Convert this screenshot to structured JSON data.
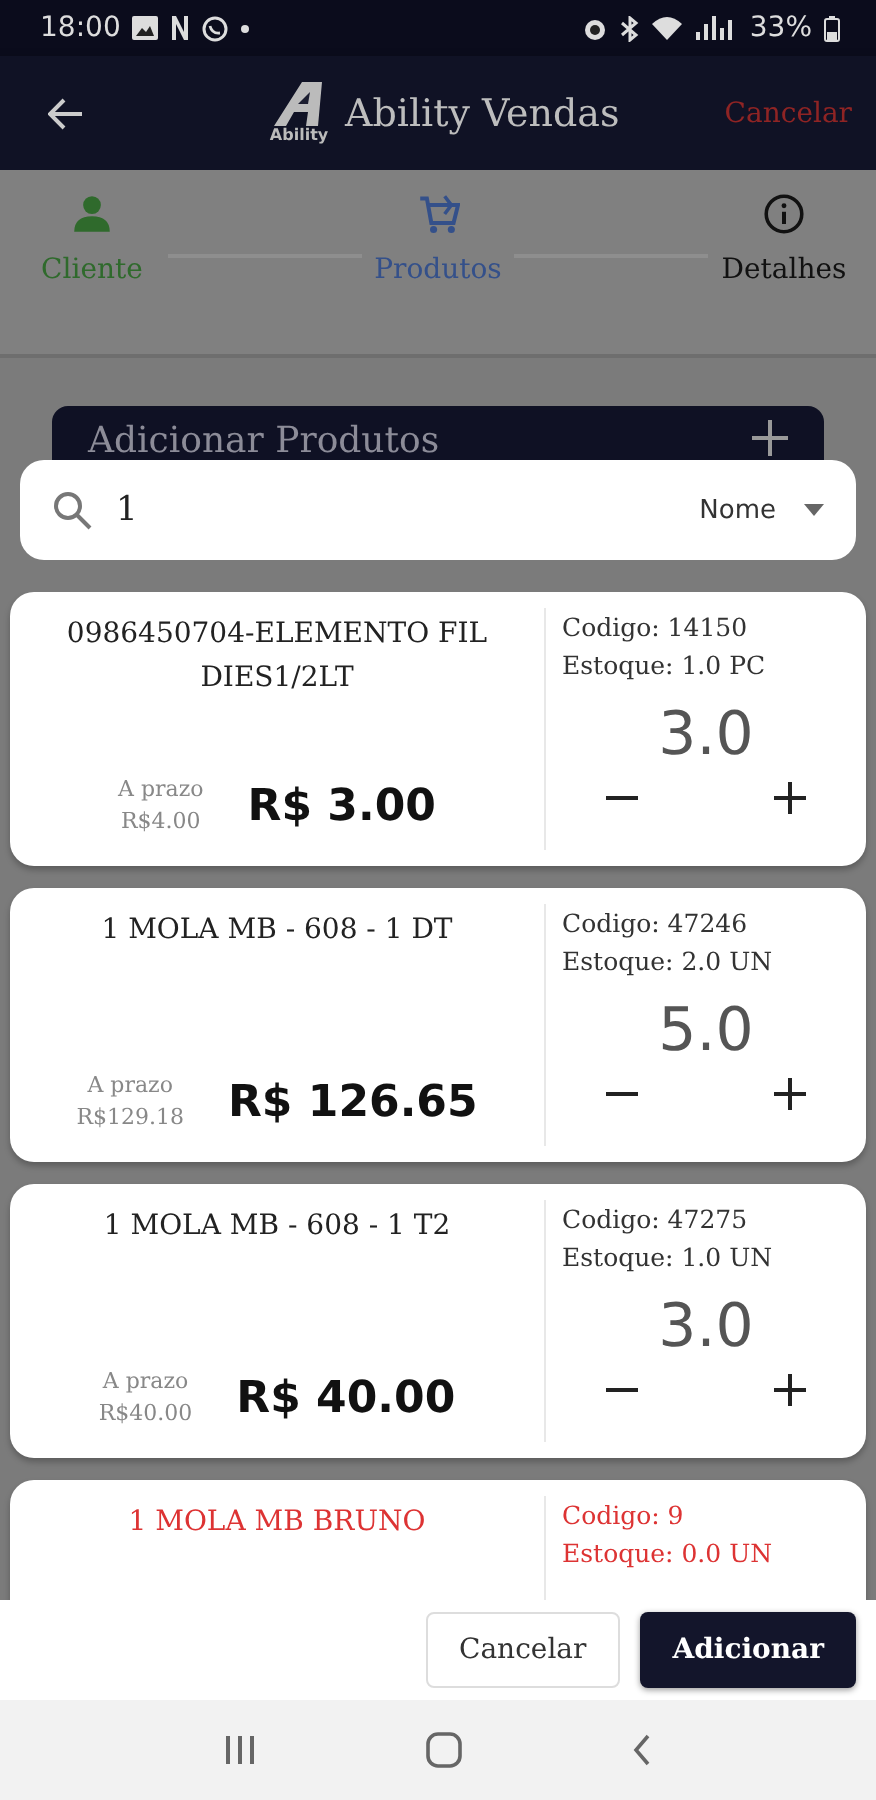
{
  "status_bar": {
    "time": "18:00",
    "battery": "33%"
  },
  "app_bar": {
    "logo_text": "Ability",
    "title": "Ability Vendas",
    "action": "Cancelar"
  },
  "steps": [
    {
      "label": "Cliente",
      "kind": "person",
      "completed": true,
      "selected": false
    },
    {
      "label": "Produtos",
      "kind": "cart",
      "completed": false,
      "selected": true
    },
    {
      "label": "Detalhes",
      "kind": "info",
      "completed": false,
      "selected": false
    }
  ],
  "section_card": {
    "title": "Adicionar Produtos"
  },
  "search": {
    "value": "1",
    "filter": "Nome"
  },
  "products": [
    {
      "name": "0986450704-ELEMENTO FIL DIES1/2LT",
      "term_label": "A prazo",
      "term_price": "R$4.00",
      "price": "R$ 3.00",
      "code": "Codigo: 14150",
      "stock": "Estoque: 1.0 PC",
      "quantity": "3.0",
      "out_of_stock": false
    },
    {
      "name": "1 MOLA MB - 608 - 1 DT",
      "term_label": "A prazo",
      "term_price": "R$129.18",
      "price": "R$ 126.65",
      "code": "Codigo: 47246",
      "stock": "Estoque: 2.0 UN",
      "quantity": "5.0",
      "out_of_stock": false
    },
    {
      "name": "1 MOLA MB - 608 - 1 T2",
      "term_label": "A prazo",
      "term_price": "R$40.00",
      "price": "R$ 40.00",
      "code": "Codigo: 47275",
      "stock": "Estoque: 1.0 UN",
      "quantity": "3.0",
      "out_of_stock": false
    },
    {
      "name": "1 MOLA MB BRUNO",
      "code": "Codigo: 9",
      "stock": "Estoque: 0.0 UN",
      "out_of_stock": true
    }
  ],
  "buttons": [
    {
      "label": "Cancelar",
      "kind": "secondary"
    },
    {
      "label": "Adicionar",
      "kind": "primary"
    }
  ]
}
